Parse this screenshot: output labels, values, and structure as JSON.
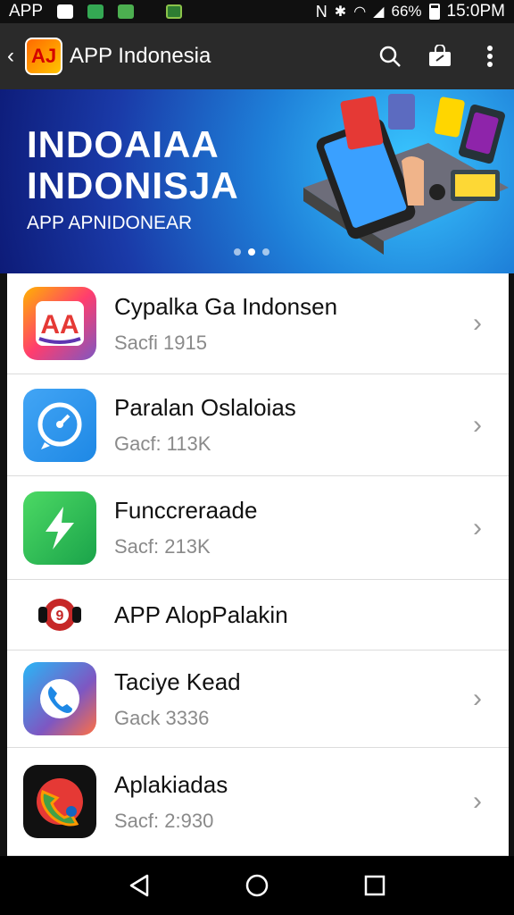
{
  "status_bar": {
    "carrier": "APP",
    "battery": "66%",
    "time": "15:0PM"
  },
  "app_bar": {
    "logo_text": "AJ",
    "title": "APP Indonesia"
  },
  "banner": {
    "title_line1": "INDOAIAA",
    "title_line2": "INDONISJA",
    "subtitle": "APP APNIDONEAR",
    "pages": 3,
    "active_page": 2
  },
  "apps": [
    {
      "name": "Cypalka Ga Indonsen",
      "size": "Sacfi 1915",
      "icon": "aa-logo-icon",
      "has_chevron": true
    },
    {
      "name": "Paralan Oslaloias",
      "size": "Gacf: 113K",
      "icon": "compass-chat-icon",
      "has_chevron": true
    },
    {
      "name": "Funccreraade",
      "size": "Sacf: 213K",
      "icon": "lightning-icon",
      "has_chevron": true
    },
    {
      "name": "APP AlopPalakin",
      "size": "",
      "icon": "headset-icon",
      "has_chevron": false
    },
    {
      "name": "Taciye Kead",
      "size": "Gack 3336",
      "icon": "phone-call-icon",
      "has_chevron": true
    },
    {
      "name": "Aplakiadas",
      "size": "Sacf: 2:930",
      "icon": "phone-handset-icon",
      "has_chevron": true
    }
  ],
  "colors": {
    "app_bar": "#2a2a2a",
    "banner_primary": "#1e7fd8",
    "list_background": "#ffffff",
    "secondary_text": "#8a8a8a"
  }
}
